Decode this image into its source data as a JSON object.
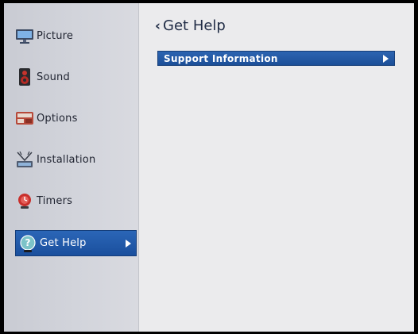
{
  "sidebar": {
    "items": [
      {
        "label": "Picture",
        "icon": "monitor-icon"
      },
      {
        "label": "Sound",
        "icon": "speaker-icon"
      },
      {
        "label": "Options",
        "icon": "options-icon"
      },
      {
        "label": "Installation",
        "icon": "antenna-icon"
      },
      {
        "label": "Timers",
        "icon": "timer-icon"
      },
      {
        "label": "Get Help",
        "icon": "help-icon",
        "selected": true
      }
    ]
  },
  "main": {
    "title": "Get Help",
    "items": [
      {
        "label": "Support Information"
      }
    ]
  },
  "colors": {
    "accent": "#1f57a6",
    "sidebar_bg": "#d3d5dc",
    "content_bg": "#ebebed",
    "bezel": "#000000"
  }
}
